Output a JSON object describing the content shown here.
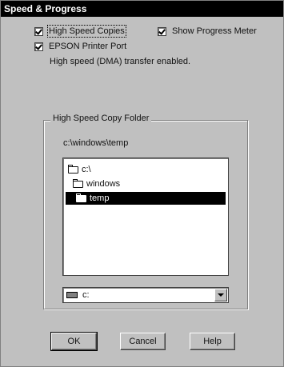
{
  "window": {
    "title": "Speed & Progress"
  },
  "options": {
    "high_speed_copies": {
      "label": "High Speed Copies",
      "checked": true
    },
    "show_progress_meter": {
      "label": "Show Progress Meter",
      "checked": true
    },
    "epson_printer_port": {
      "label": "EPSON Printer Port",
      "checked": true
    },
    "status_text": "High speed (DMA) transfer enabled."
  },
  "copy_folder": {
    "group_title": "High Speed Copy Folder",
    "path": "c:\\windows\\temp",
    "tree": [
      {
        "label": "c:\\",
        "state": "open"
      },
      {
        "label": "windows",
        "state": "open"
      },
      {
        "label": "temp",
        "state": "closed",
        "selected": true
      }
    ],
    "drive": {
      "label": "c:",
      "icon": "drive-icon"
    }
  },
  "buttons": {
    "ok": "OK",
    "cancel": "Cancel",
    "help": "Help"
  }
}
